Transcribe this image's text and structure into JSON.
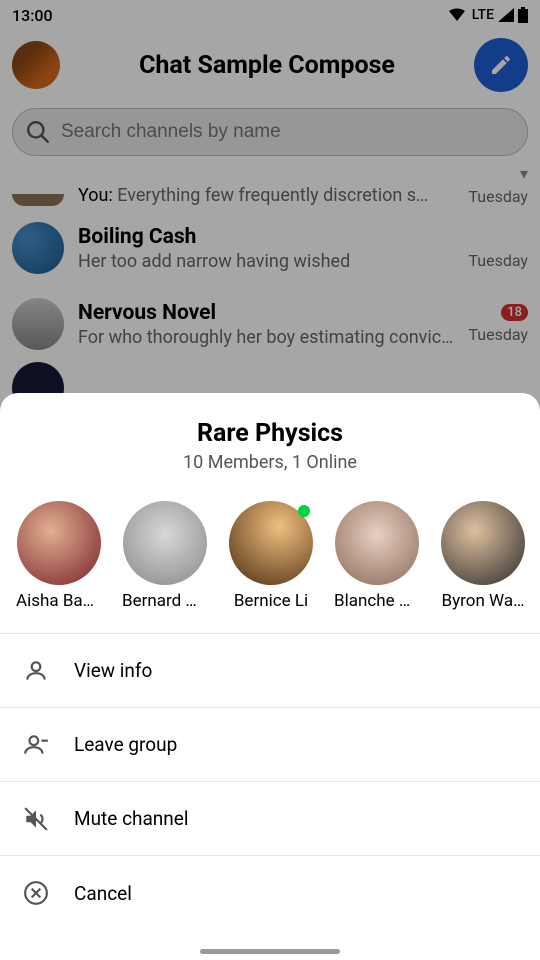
{
  "status": {
    "time": "13:00",
    "network": "LTE"
  },
  "header": {
    "title": "Chat Sample Compose"
  },
  "search": {
    "placeholder": "Search channels by name"
  },
  "chats": {
    "partial_top": {
      "you_prefix": "You:",
      "preview": "Everything few frequently discretion s…",
      "date": "Tuesday"
    },
    "boiling": {
      "name": "Boiling Cash",
      "preview": "Her too add narrow having wished",
      "date": "Tuesday"
    },
    "nervous": {
      "name": "Nervous Novel",
      "preview": "For who thoroughly her boy estimating convict…",
      "date": "Tuesday",
      "badge": "18"
    },
    "partial_bottom": {
      "name_partial": ""
    }
  },
  "sheet": {
    "title": "Rare Physics",
    "subtitle": "10 Members, 1 Online",
    "members": [
      {
        "name": "Aisha Bad…",
        "online": false
      },
      {
        "name": "Bernard W…",
        "online": false
      },
      {
        "name": "Bernice Li",
        "online": true
      },
      {
        "name": "Blanche S…",
        "online": false
      },
      {
        "name": "Byron Wa…",
        "online": false
      }
    ],
    "options": {
      "view_info": "View info",
      "leave": "Leave group",
      "mute": "Mute channel",
      "cancel": "Cancel"
    }
  }
}
